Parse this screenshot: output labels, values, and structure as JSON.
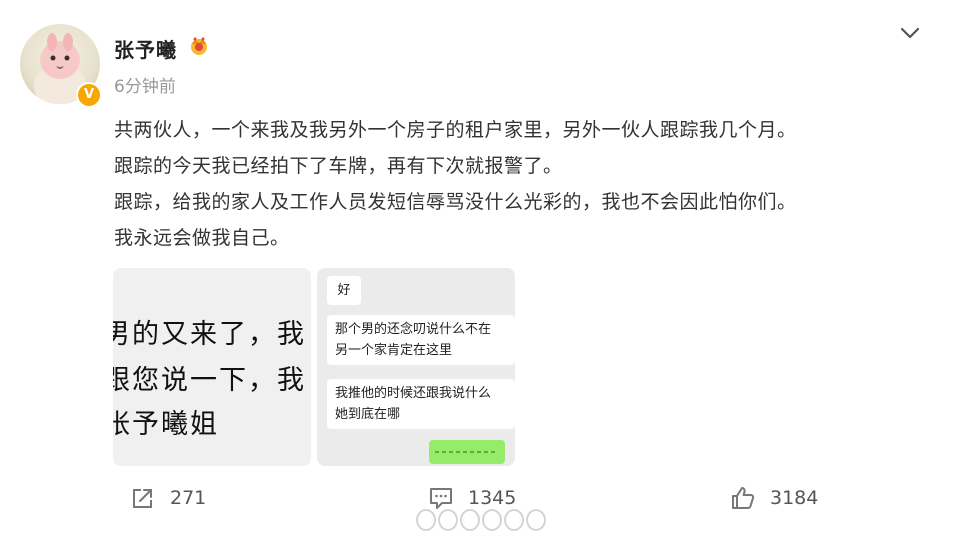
{
  "user": {
    "name": "张予曦",
    "time": "6分钟前",
    "verified_mark": "V",
    "icons": [
      "avatar",
      "verified-badge-icon",
      "crown-icon",
      "chevron-down-icon"
    ]
  },
  "post": {
    "lines": [
      "共两伙人，一个来我及我另外一个房子的租户家里，另外一伙人跟踪我几个月。",
      "跟踪的今天我已经拍下了车牌，再有下次就报警了。",
      "跟踪，给我的家人及工作人员发短信辱骂没什么光彩的，我也不会因此怕你们。",
      "我永远会做我自己。"
    ]
  },
  "image1": {
    "lines": [
      "男的又来了，我",
      "跟您说一下，我",
      "张予曦姐"
    ]
  },
  "image2": {
    "messages": [
      {
        "lines": [
          "好"
        ]
      },
      {
        "lines": [
          "那个男的还念叨说什么不在",
          "另一个家肯定在这里"
        ]
      },
      {
        "lines": [
          "我推他的时候还跟我说什么",
          "她到底在哪"
        ]
      }
    ],
    "green_bubble_color": "#95ec69"
  },
  "actions": {
    "repost": {
      "count": "271",
      "icon": "repost-icon"
    },
    "comment": {
      "count": "1345",
      "icon": "comment-icon"
    },
    "like": {
      "count": "3184",
      "icon": "thumbs-up-icon"
    }
  },
  "colors": {
    "accent_verified": "#f7a700",
    "text_primary": "#333333",
    "text_secondary": "#999999"
  }
}
